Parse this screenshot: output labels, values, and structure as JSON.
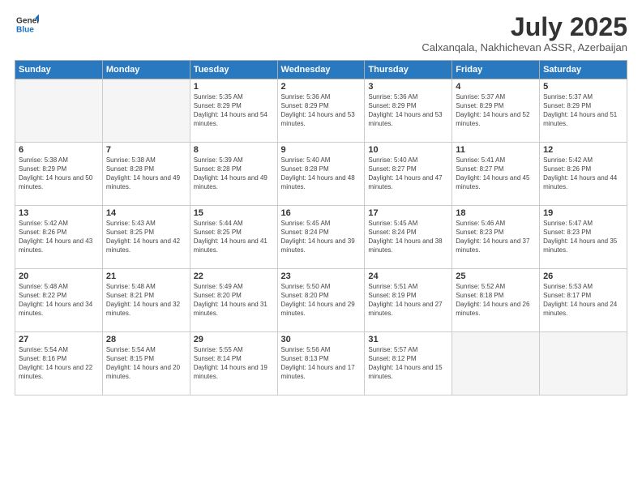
{
  "logo": {
    "line1": "General",
    "line2": "Blue"
  },
  "title": "July 2025",
  "subtitle": "Calxanqala, Nakhichevan ASSR, Azerbaijan",
  "weekdays": [
    "Sunday",
    "Monday",
    "Tuesday",
    "Wednesday",
    "Thursday",
    "Friday",
    "Saturday"
  ],
  "weeks": [
    [
      {
        "day": "",
        "info": ""
      },
      {
        "day": "",
        "info": ""
      },
      {
        "day": "1",
        "info": "Sunrise: 5:35 AM\nSunset: 8:29 PM\nDaylight: 14 hours and 54 minutes."
      },
      {
        "day": "2",
        "info": "Sunrise: 5:36 AM\nSunset: 8:29 PM\nDaylight: 14 hours and 53 minutes."
      },
      {
        "day": "3",
        "info": "Sunrise: 5:36 AM\nSunset: 8:29 PM\nDaylight: 14 hours and 53 minutes."
      },
      {
        "day": "4",
        "info": "Sunrise: 5:37 AM\nSunset: 8:29 PM\nDaylight: 14 hours and 52 minutes."
      },
      {
        "day": "5",
        "info": "Sunrise: 5:37 AM\nSunset: 8:29 PM\nDaylight: 14 hours and 51 minutes."
      }
    ],
    [
      {
        "day": "6",
        "info": "Sunrise: 5:38 AM\nSunset: 8:29 PM\nDaylight: 14 hours and 50 minutes."
      },
      {
        "day": "7",
        "info": "Sunrise: 5:38 AM\nSunset: 8:28 PM\nDaylight: 14 hours and 49 minutes."
      },
      {
        "day": "8",
        "info": "Sunrise: 5:39 AM\nSunset: 8:28 PM\nDaylight: 14 hours and 49 minutes."
      },
      {
        "day": "9",
        "info": "Sunrise: 5:40 AM\nSunset: 8:28 PM\nDaylight: 14 hours and 48 minutes."
      },
      {
        "day": "10",
        "info": "Sunrise: 5:40 AM\nSunset: 8:27 PM\nDaylight: 14 hours and 47 minutes."
      },
      {
        "day": "11",
        "info": "Sunrise: 5:41 AM\nSunset: 8:27 PM\nDaylight: 14 hours and 45 minutes."
      },
      {
        "day": "12",
        "info": "Sunrise: 5:42 AM\nSunset: 8:26 PM\nDaylight: 14 hours and 44 minutes."
      }
    ],
    [
      {
        "day": "13",
        "info": "Sunrise: 5:42 AM\nSunset: 8:26 PM\nDaylight: 14 hours and 43 minutes."
      },
      {
        "day": "14",
        "info": "Sunrise: 5:43 AM\nSunset: 8:25 PM\nDaylight: 14 hours and 42 minutes."
      },
      {
        "day": "15",
        "info": "Sunrise: 5:44 AM\nSunset: 8:25 PM\nDaylight: 14 hours and 41 minutes."
      },
      {
        "day": "16",
        "info": "Sunrise: 5:45 AM\nSunset: 8:24 PM\nDaylight: 14 hours and 39 minutes."
      },
      {
        "day": "17",
        "info": "Sunrise: 5:45 AM\nSunset: 8:24 PM\nDaylight: 14 hours and 38 minutes."
      },
      {
        "day": "18",
        "info": "Sunrise: 5:46 AM\nSunset: 8:23 PM\nDaylight: 14 hours and 37 minutes."
      },
      {
        "day": "19",
        "info": "Sunrise: 5:47 AM\nSunset: 8:23 PM\nDaylight: 14 hours and 35 minutes."
      }
    ],
    [
      {
        "day": "20",
        "info": "Sunrise: 5:48 AM\nSunset: 8:22 PM\nDaylight: 14 hours and 34 minutes."
      },
      {
        "day": "21",
        "info": "Sunrise: 5:48 AM\nSunset: 8:21 PM\nDaylight: 14 hours and 32 minutes."
      },
      {
        "day": "22",
        "info": "Sunrise: 5:49 AM\nSunset: 8:20 PM\nDaylight: 14 hours and 31 minutes."
      },
      {
        "day": "23",
        "info": "Sunrise: 5:50 AM\nSunset: 8:20 PM\nDaylight: 14 hours and 29 minutes."
      },
      {
        "day": "24",
        "info": "Sunrise: 5:51 AM\nSunset: 8:19 PM\nDaylight: 14 hours and 27 minutes."
      },
      {
        "day": "25",
        "info": "Sunrise: 5:52 AM\nSunset: 8:18 PM\nDaylight: 14 hours and 26 minutes."
      },
      {
        "day": "26",
        "info": "Sunrise: 5:53 AM\nSunset: 8:17 PM\nDaylight: 14 hours and 24 minutes."
      }
    ],
    [
      {
        "day": "27",
        "info": "Sunrise: 5:54 AM\nSunset: 8:16 PM\nDaylight: 14 hours and 22 minutes."
      },
      {
        "day": "28",
        "info": "Sunrise: 5:54 AM\nSunset: 8:15 PM\nDaylight: 14 hours and 20 minutes."
      },
      {
        "day": "29",
        "info": "Sunrise: 5:55 AM\nSunset: 8:14 PM\nDaylight: 14 hours and 19 minutes."
      },
      {
        "day": "30",
        "info": "Sunrise: 5:56 AM\nSunset: 8:13 PM\nDaylight: 14 hours and 17 minutes."
      },
      {
        "day": "31",
        "info": "Sunrise: 5:57 AM\nSunset: 8:12 PM\nDaylight: 14 hours and 15 minutes."
      },
      {
        "day": "",
        "info": ""
      },
      {
        "day": "",
        "info": ""
      }
    ]
  ]
}
